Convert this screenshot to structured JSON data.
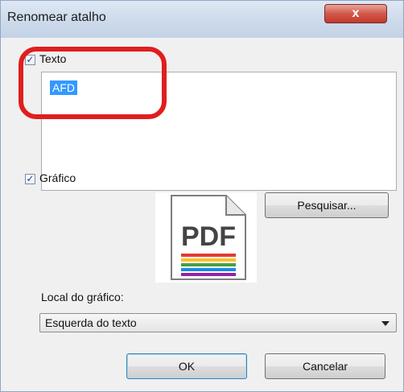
{
  "dialog": {
    "title": "Renomear atalho",
    "close_symbol": "x"
  },
  "text_section": {
    "checkbox_label": "Texto",
    "checked": true,
    "value": "AFD"
  },
  "graphic_section": {
    "checkbox_label": "Gráfico",
    "checked": true,
    "preview_icon": "pdf-file-icon",
    "preview_text": "PDF",
    "browse_label": "Pesquisar..."
  },
  "placement": {
    "label": "Local do gráfico:",
    "selected": "Esquerda do texto"
  },
  "buttons": {
    "ok_label": "OK",
    "cancel_label": "Cancelar"
  },
  "colors": {
    "highlight_ring": "#e01e1e",
    "selection": "#3399ff",
    "close_button": "#c9473a"
  }
}
